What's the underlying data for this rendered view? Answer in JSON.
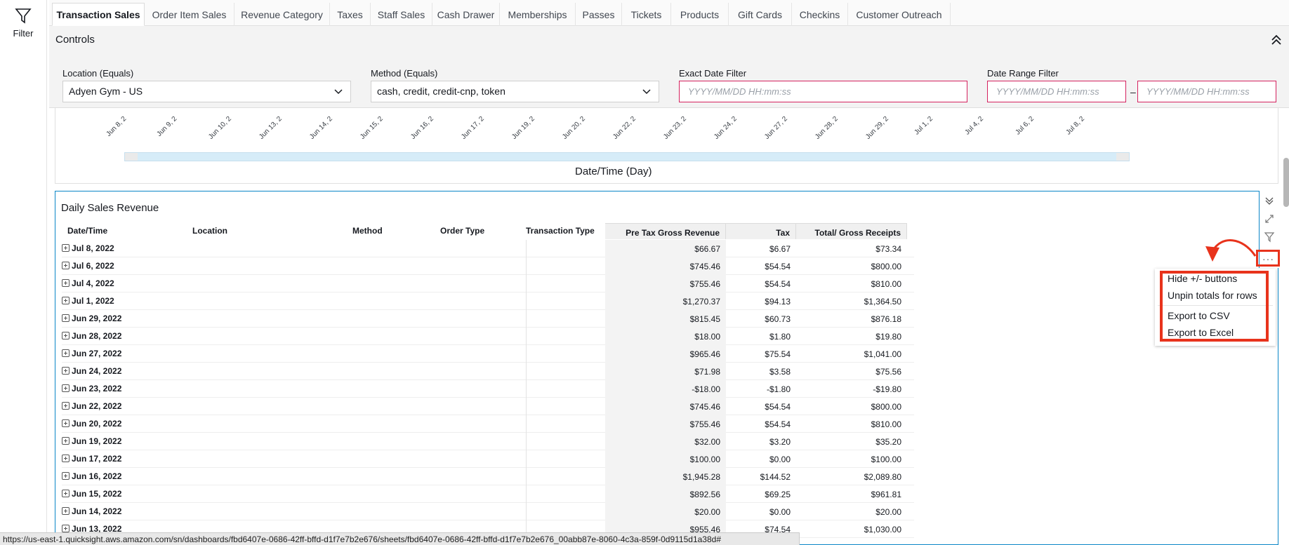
{
  "rail": {
    "filter_label": "Filter"
  },
  "tabs": [
    {
      "label": "Transaction Sales",
      "active": true
    },
    {
      "label": "Order Item Sales"
    },
    {
      "label": "Revenue Category"
    },
    {
      "label": "Taxes"
    },
    {
      "label": "Staff Sales"
    },
    {
      "label": "Cash Drawer"
    },
    {
      "label": "Memberships"
    },
    {
      "label": "Passes"
    },
    {
      "label": "Tickets"
    },
    {
      "label": "Products"
    },
    {
      "label": "Gift Cards"
    },
    {
      "label": "Checkins"
    },
    {
      "label": "Customer Outreach"
    }
  ],
  "controls": {
    "title": "Controls",
    "location": {
      "label": "Location (Equals)",
      "value": "Adyen Gym - US"
    },
    "method": {
      "label": "Method (Equals)",
      "value": "cash, credit, credit-cnp, token"
    },
    "exact_date": {
      "label": "Exact Date Filter",
      "placeholder": "YYYY/MM/DD HH:mm:ss"
    },
    "date_range": {
      "label": "Date Range Filter",
      "from_placeholder": "YYYY/MM/DD HH:mm:ss",
      "separator": "–",
      "to_placeholder": "YYYY/MM/DD HH:mm:ss"
    }
  },
  "timeline": {
    "ticks": [
      "Jun 8, 2",
      "Jun 9, 2",
      "Jun 10, 2",
      "Jun 13, 2",
      "Jun 14, 2",
      "Jun 15, 2",
      "Jun 16, 2",
      "Jun 17, 2",
      "Jun 19, 2",
      "Jun 20, 2",
      "Jun 22, 2",
      "Jun 23, 2",
      "Jun 24, 2",
      "Jun 27, 2",
      "Jun 28, 2",
      "Jun 29, 2",
      "Jul 1, 2",
      "Jul 4, 2",
      "Jul 6, 2",
      "Jul 8, 2"
    ],
    "axis_title": "Date/Time (Day)"
  },
  "table": {
    "title": "Daily Sales Revenue",
    "headers": {
      "date": "Date/Time",
      "location": "Location",
      "method": "Method",
      "order_type": "Order Type",
      "transaction_type": "Transaction Type",
      "pretax": "Pre Tax Gross Revenue",
      "tax": "Tax",
      "total": "Total/ Gross Receipts"
    },
    "rows": [
      {
        "date": "Jul 8, 2022",
        "pretax": "$66.67",
        "tax": "$6.67",
        "total": "$73.34"
      },
      {
        "date": "Jul 6, 2022",
        "pretax": "$745.46",
        "tax": "$54.54",
        "total": "$800.00"
      },
      {
        "date": "Jul 4, 2022",
        "pretax": "$755.46",
        "tax": "$54.54",
        "total": "$810.00"
      },
      {
        "date": "Jul 1, 2022",
        "pretax": "$1,270.37",
        "tax": "$94.13",
        "total": "$1,364.50"
      },
      {
        "date": "Jun 29, 2022",
        "pretax": "$815.45",
        "tax": "$60.73",
        "total": "$876.18"
      },
      {
        "date": "Jun 28, 2022",
        "pretax": "$18.00",
        "tax": "$1.80",
        "total": "$19.80"
      },
      {
        "date": "Jun 27, 2022",
        "pretax": "$965.46",
        "tax": "$75.54",
        "total": "$1,041.00"
      },
      {
        "date": "Jun 24, 2022",
        "pretax": "$71.98",
        "tax": "$3.58",
        "total": "$75.56"
      },
      {
        "date": "Jun 23, 2022",
        "pretax": "-$18.00",
        "tax": "-$1.80",
        "total": "-$19.80"
      },
      {
        "date": "Jun 22, 2022",
        "pretax": "$745.46",
        "tax": "$54.54",
        "total": "$800.00"
      },
      {
        "date": "Jun 20, 2022",
        "pretax": "$755.46",
        "tax": "$54.54",
        "total": "$810.00"
      },
      {
        "date": "Jun 19, 2022",
        "pretax": "$32.00",
        "tax": "$3.20",
        "total": "$35.20"
      },
      {
        "date": "Jun 17, 2022",
        "pretax": "$100.00",
        "tax": "$0.00",
        "total": "$100.00"
      },
      {
        "date": "Jun 16, 2022",
        "pretax": "$1,945.28",
        "tax": "$144.52",
        "total": "$2,089.80"
      },
      {
        "date": "Jun 15, 2022",
        "pretax": "$892.56",
        "tax": "$69.25",
        "total": "$961.81"
      },
      {
        "date": "Jun 14, 2022",
        "pretax": "$20.00",
        "tax": "$0.00",
        "total": "$20.00"
      },
      {
        "date": "Jun 13, 2022",
        "pretax": "$955.46",
        "tax": "$74.54",
        "total": "$1,030.00"
      }
    ]
  },
  "context_menu": {
    "items": [
      "Hide +/- buttons",
      "Unpin totals for rows",
      "Export to CSV",
      "Export to Excel"
    ],
    "highlight_color": "#e8331c"
  },
  "statusbar": {
    "url": "https://us-east-1.quicksight.aws.amazon.com/sn/dashboards/fbd6407e-0686-42ff-bffd-d1f7e7b2e676/sheets/fbd6407e-0686-42ff-bffd-d1f7e7b2e676_00abb87e-8060-4c3a-859f-0d9115d1a38d#"
  },
  "colors": {
    "accent": "#0a86c7",
    "error_border": "#d5225f",
    "annotation": "#e8331c"
  }
}
